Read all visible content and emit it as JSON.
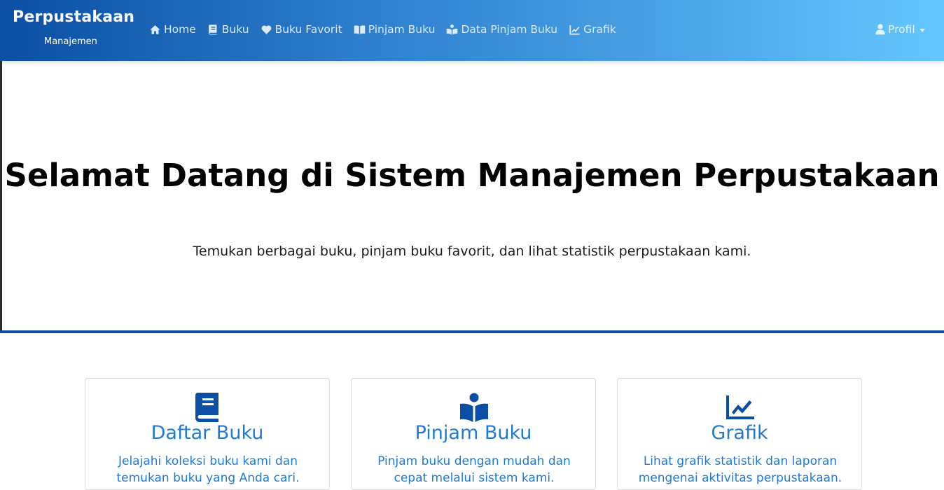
{
  "navbar": {
    "brand_title": "Perpustakaan",
    "brand_subtitle": "Manajemen",
    "links": [
      {
        "label": "Home",
        "icon": "home-icon"
      },
      {
        "label": "Buku",
        "icon": "book-icon"
      },
      {
        "label": "Buku Favorit",
        "icon": "heart-icon"
      },
      {
        "label": "Pinjam Buku",
        "icon": "open-book-icon"
      },
      {
        "label": "Data Pinjam Buku",
        "icon": "book-reader-icon"
      },
      {
        "label": "Grafik",
        "icon": "chart-line-icon"
      }
    ],
    "profile_label": "Profil"
  },
  "hero": {
    "title": "Selamat Datang di Sistem Manajemen Perpustakaan",
    "subtitle": "Temukan berbagai buku, pinjam buku favorit, dan lihat statistik perpustakaan kami."
  },
  "cards": [
    {
      "title": "Daftar Buku",
      "text": "Jelajahi koleksi buku kami dan temukan buku yang Anda cari.",
      "icon": "book-icon"
    },
    {
      "title": "Pinjam Buku",
      "text": "Pinjam buku dengan mudah dan cepat melalui sistem kami.",
      "icon": "book-reader-icon"
    },
    {
      "title": "Grafik",
      "text": "Lihat grafik statistik dan laporan mengenai aktivitas perpustakaan.",
      "icon": "chart-line-icon"
    }
  ],
  "colors": {
    "primary": "#0a4fa3",
    "link_blue": "#1d7ad8",
    "navbar_gradient_end": "#64c7ff"
  }
}
